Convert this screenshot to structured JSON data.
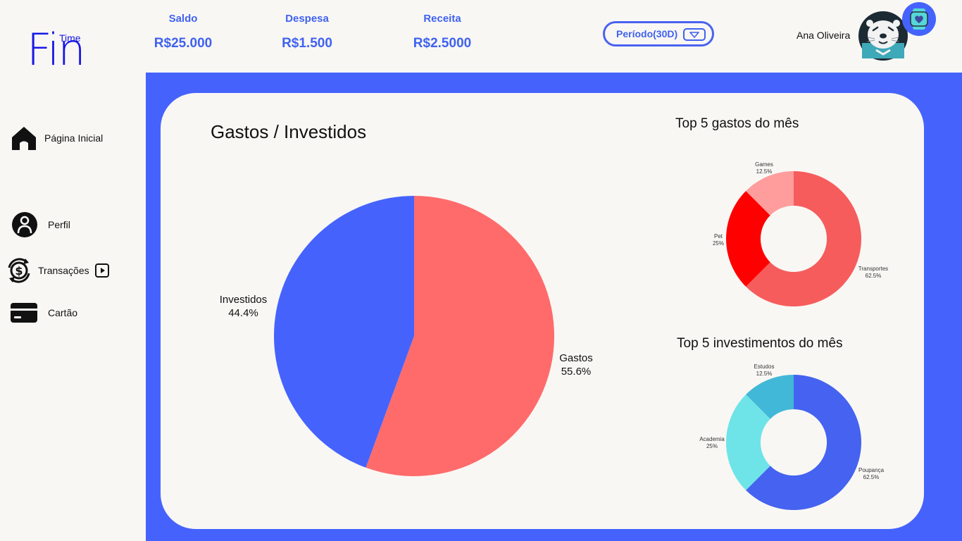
{
  "app": {
    "logo_main": "Fin",
    "logo_sup": "Time"
  },
  "header": {
    "stats": [
      {
        "label": "Saldo",
        "value": "R$25.000"
      },
      {
        "label": "Despesa",
        "value": "R$1.500"
      },
      {
        "label": "Receita",
        "value": "R$2.5000"
      }
    ],
    "period_label": "Período(30D)",
    "user_name": "Ana Oliveira"
  },
  "sidebar": {
    "items": [
      {
        "label": "Página Inicial",
        "icon": "home-icon"
      },
      {
        "label": "Perfil",
        "icon": "user-icon"
      },
      {
        "label": "Transações",
        "icon": "dollar-refresh-icon"
      },
      {
        "label": "Cartão",
        "icon": "credit-card-icon"
      }
    ]
  },
  "colors": {
    "primary": "#4563fc",
    "gastos": "#ff6b6b",
    "transportes": "#f65c5c",
    "pet": "#ff0000",
    "games": "#ff9c9c",
    "poupanca": "#4563f0",
    "academia": "#6ee4e8",
    "estudos": "#42b8d8"
  },
  "main": {
    "pie_title": "Gastos / Investidos",
    "top_gastos_title": "Top 5 gastos do mês",
    "top_invest_title": "Top 5  investimentos do mês"
  },
  "chart_data": [
    {
      "type": "pie",
      "title": "Gastos / Investidos",
      "labels": [
        "Gastos",
        "Investidos"
      ],
      "values": [
        55.6,
        44.4
      ],
      "value_labels": [
        "55.6%",
        "44.4%"
      ]
    },
    {
      "type": "pie",
      "subtype": "donut",
      "title": "Top 5 gastos do mês",
      "labels": [
        "Transportes",
        "Pet",
        "Games"
      ],
      "values": [
        62.5,
        25,
        12.5
      ],
      "value_labels": [
        "62.5%",
        "25%",
        "12.5%"
      ]
    },
    {
      "type": "pie",
      "subtype": "donut",
      "title": "Top 5  investimentos do mês",
      "labels": [
        "Poupança",
        "Academia",
        "Estudos"
      ],
      "values": [
        62.5,
        25,
        12.5
      ],
      "value_labels": [
        "62.5%",
        "25%",
        "12.5%"
      ]
    }
  ]
}
